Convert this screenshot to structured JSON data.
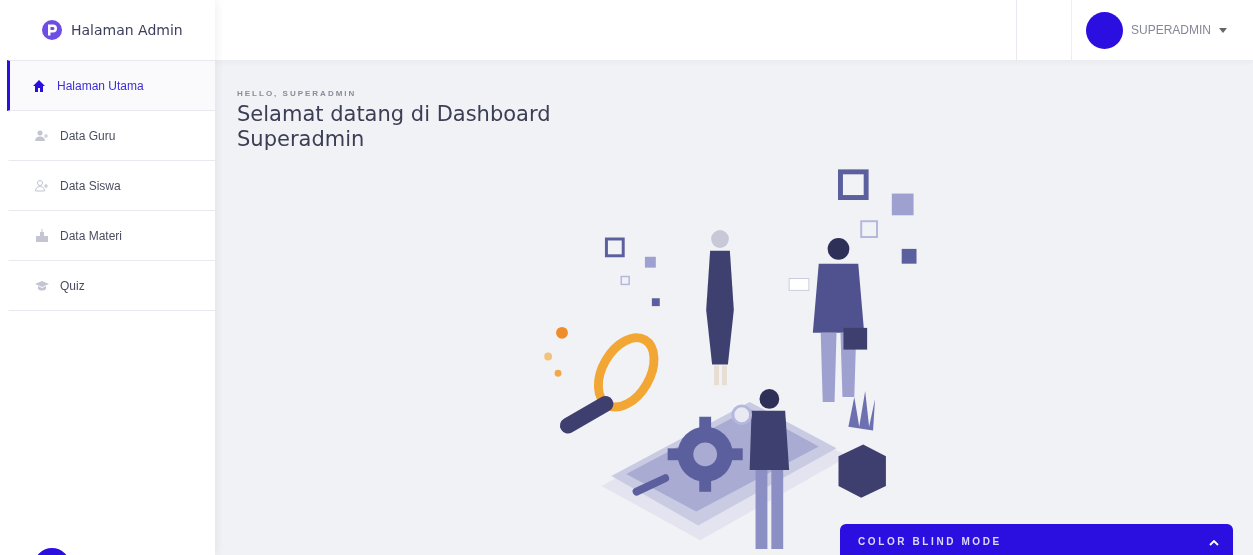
{
  "brand": {
    "title": "Halaman Admin"
  },
  "sidebar": {
    "items": [
      {
        "label": "Halaman Utama",
        "selected": true
      },
      {
        "label": "Data Guru",
        "selected": false
      },
      {
        "label": "Data Siswa",
        "selected": false
      },
      {
        "label": "Data Materi",
        "selected": false
      },
      {
        "label": "Quiz",
        "selected": false
      }
    ]
  },
  "user_menu": {
    "name": "SUPERADMIN"
  },
  "main": {
    "greeting": "HELLO, SUPERADMIN",
    "heading": "Selamat datang di Dashboard Superadmin"
  },
  "color_blind_panel": {
    "title": "COLOR BLIND MODE",
    "expanded": false
  }
}
